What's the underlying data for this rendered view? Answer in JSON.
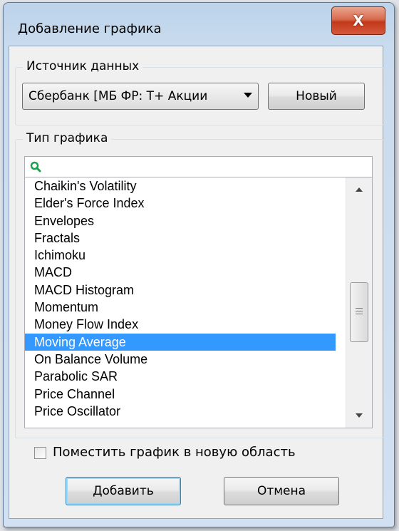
{
  "window": {
    "title": "Добавление графика",
    "close_label": "X"
  },
  "source_group": {
    "legend": "Источник данных",
    "combo_value": "Сбербанк [МБ ФР: Т+ Акции",
    "new_button": "Новый"
  },
  "type_group": {
    "legend": "Тип графика",
    "search_icon": "search-icon",
    "items": [
      "Chaikin's Volatility",
      "Elder's Force Index",
      "Envelopes",
      "Fractals",
      "Ichimoku",
      "MACD",
      "MACD Histogram",
      "Momentum",
      "Money Flow Index",
      "Moving Average",
      "On Balance Volume",
      "Parabolic SAR",
      "Price Channel",
      "Price Oscillator"
    ],
    "selected_item": "Moving Average"
  },
  "new_area_checkbox": {
    "label": "Поместить график в новую область",
    "checked": false
  },
  "buttons": {
    "add": "Добавить",
    "cancel": "Отмена"
  },
  "colors": {
    "selection": "#3399ff",
    "close_button": "#c2391a",
    "search_icon": "#1aa34a"
  }
}
